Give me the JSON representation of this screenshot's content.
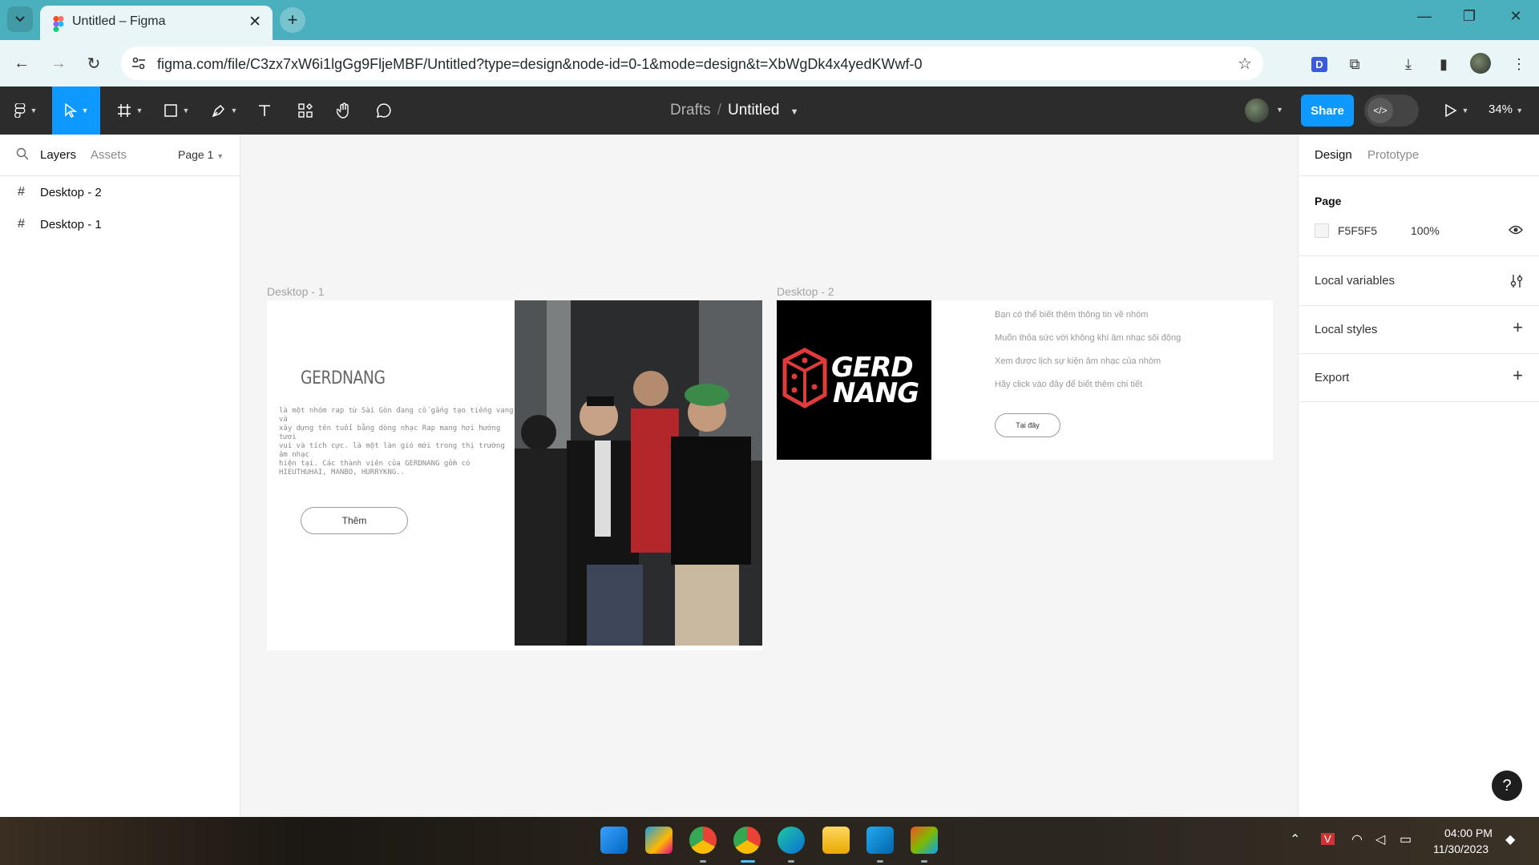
{
  "browser": {
    "tab_title": "Untitled – Figma",
    "url": "figma.com/file/C3zx7xW6i1lgGg9FljeMBF/Untitled?type=design&node-id=0-1&mode=design&t=XbWgDk4x4yedKWwf-0"
  },
  "figma": {
    "breadcrumb_parent": "Drafts",
    "breadcrumb_sep": "/",
    "file_name": "Untitled",
    "share_label": "Share",
    "zoom": "34%"
  },
  "left_panel": {
    "tab_layers": "Layers",
    "tab_assets": "Assets",
    "page_selector": "Page 1",
    "layers": [
      {
        "label": "Desktop - 2"
      },
      {
        "label": "Desktop - 1"
      }
    ]
  },
  "right_panel": {
    "tab_design": "Design",
    "tab_prototype": "Prototype",
    "page_title": "Page",
    "page_color": "F5F5F5",
    "page_opacity": "100%",
    "local_variables": "Local variables",
    "local_styles": "Local styles",
    "export": "Export"
  },
  "canvas": {
    "frame1": {
      "label": "Desktop - 1",
      "heading": "GERDNANG",
      "description": "là một nhóm rap từ Sài Gòn đang cố gắng tạo tiếng vang và\nxây dựng tên tuổi bằng dòng nhạc Rap mang hơi hướng tươi\nvui và tích cực. là một làn gió mới trong thị trường âm nhạc\nhiện tại. Các thành viên của GERDNANG gồm có HIEUTHUHAI, MANBO, HURRYKNG..",
      "button": "Thêm"
    },
    "frame2": {
      "label": "Desktop - 2",
      "logo_line1": "GERD",
      "logo_line2": "NANG",
      "lines": [
        "Bạn có thể biết thêm thông tin về nhóm",
        "Muốn thỏa sức với không khí âm nhạc sôi động",
        "Xem được lịch sự kiện âm nhạc của nhóm",
        "Hãy click vào đây để biết thêm chi tiết"
      ],
      "button": "Tại đây"
    }
  },
  "taskbar": {
    "time": "04:00 PM",
    "date": "11/30/2023"
  },
  "colors": {
    "figma_blue": "#0d99ff",
    "chrome_tab_bar": "#4bb0be",
    "toolbar_dark": "#2c2c2c"
  }
}
